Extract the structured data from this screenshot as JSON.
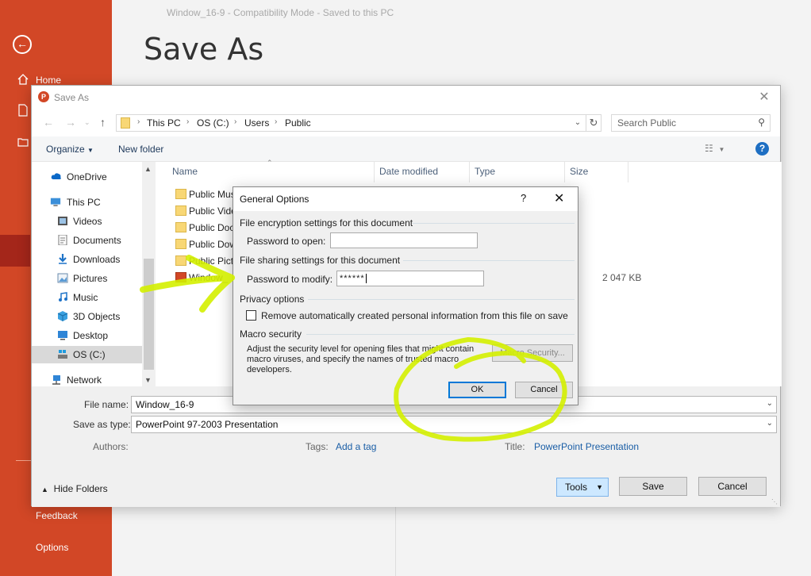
{
  "backstage": {
    "doc_title": "Window_16-9  -  Compatibility Mode  -  Saved to this PC",
    "heading": "Save As",
    "home": "Home",
    "feedback": "Feedback",
    "options": "Options",
    "accent_color": "#d24726"
  },
  "save_as_dialog": {
    "title": "Save As",
    "breadcrumb": [
      "This PC",
      "OS (C:)",
      "Users",
      "Public"
    ],
    "search_placeholder": "Search Public",
    "organize": "Organize",
    "new_folder": "New folder",
    "nav": [
      {
        "label": "OneDrive",
        "icon": "cloud-icon"
      },
      {
        "label": "This PC",
        "icon": "computer-icon"
      },
      {
        "label": "Videos",
        "icon": "video-icon"
      },
      {
        "label": "Documents",
        "icon": "document-icon"
      },
      {
        "label": "Downloads",
        "icon": "download-icon"
      },
      {
        "label": "Pictures",
        "icon": "picture-icon"
      },
      {
        "label": "Music",
        "icon": "music-icon"
      },
      {
        "label": "3D Objects",
        "icon": "cube-icon"
      },
      {
        "label": "Desktop",
        "icon": "desktop-icon"
      },
      {
        "label": "OS (C:)",
        "icon": "drive-icon",
        "selected": true
      },
      {
        "label": "Network",
        "icon": "network-icon"
      }
    ],
    "columns": [
      "Name",
      "Date modified",
      "Type",
      "Size"
    ],
    "files": [
      {
        "name": "Public Mus",
        "size": ""
      },
      {
        "name": "Public Vide",
        "size": ""
      },
      {
        "name": "Public Doc",
        "size": ""
      },
      {
        "name": "Public Dow",
        "size": ""
      },
      {
        "name": "Public Pict",
        "size": ""
      },
      {
        "name": "Window_",
        "size": "2 047 KB"
      }
    ],
    "file_name_label": "File name:",
    "file_name_value": "Window_16-9",
    "save_type_label": "Save as type:",
    "save_type_value": "PowerPoint 97-2003 Presentation",
    "authors_label": "Authors:",
    "tags_label": "Tags:",
    "tags_link": "Add a tag",
    "title_label": "Title:",
    "title_link": "PowerPoint Presentation",
    "hide_folders": "Hide Folders",
    "tools": "Tools",
    "save": "Save",
    "cancel": "Cancel"
  },
  "general_options": {
    "title": "General Options",
    "help": "?",
    "encryption_heading": "File encryption settings for this document",
    "pw_open_label": "Password to open:",
    "pw_open_value": "",
    "sharing_heading": "File sharing settings for this document",
    "pw_modify_label": "Password to modify:",
    "pw_modify_value": "******",
    "privacy_heading": "Privacy options",
    "privacy_checkbox_label": "Remove automatically created personal information from this file on save",
    "privacy_checked": false,
    "macro_heading": "Macro security",
    "macro_description": "Adjust the security level for opening files that might contain macro viruses, and specify the names of trusted macro developers.",
    "macro_button": "Macro Security...",
    "ok": "OK",
    "cancel": "Cancel"
  },
  "annotation": {
    "highlight_color": "#d4f000",
    "marks": [
      "arrow-to-password-to-modify",
      "circle-around-ok-button"
    ]
  }
}
